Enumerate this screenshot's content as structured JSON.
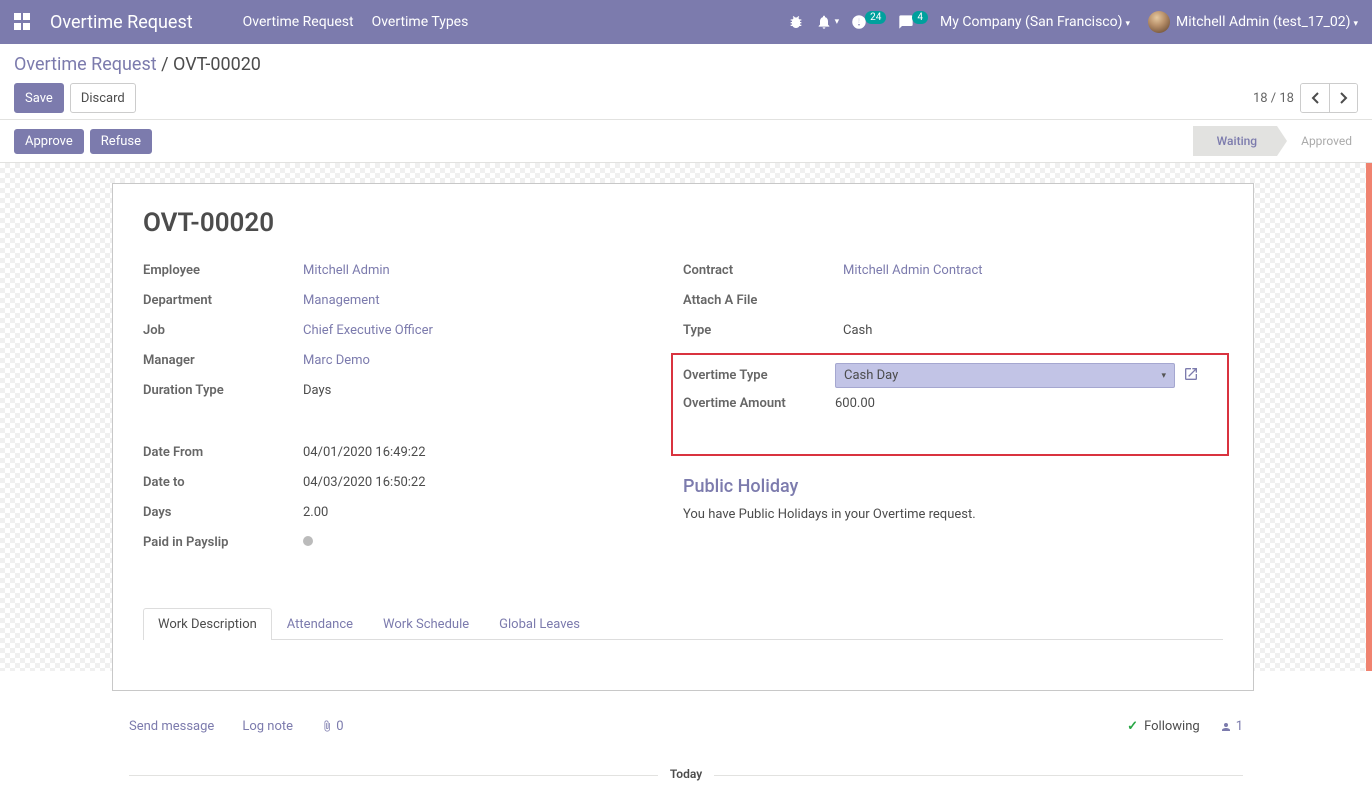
{
  "navbar": {
    "title": "Overtime Request",
    "menu": [
      "Overtime Request",
      "Overtime Types"
    ],
    "activity_badge": "24",
    "discuss_badge": "4",
    "company": "My Company (San Francisco)",
    "user": "Mitchell Admin (test_17_02)"
  },
  "breadcrumb": {
    "root": "Overtime Request",
    "sep": " / ",
    "current": "OVT-00020"
  },
  "controls": {
    "save": "Save",
    "discard": "Discard",
    "pager": "18 / 18"
  },
  "statusbar": {
    "approve": "Approve",
    "refuse": "Refuse",
    "waiting": "Waiting",
    "approved": "Approved"
  },
  "form": {
    "title": "OVT-00020",
    "left1": {
      "employee_label": "Employee",
      "employee": "Mitchell Admin",
      "department_label": "Department",
      "department": "Management",
      "job_label": "Job",
      "job": "Chief Executive Officer",
      "manager_label": "Manager",
      "manager": "Marc Demo",
      "duration_type_label": "Duration Type",
      "duration_type": "Days"
    },
    "left2": {
      "date_from_label": "Date From",
      "date_from": "04/01/2020 16:49:22",
      "date_to_label": "Date to",
      "date_to": "04/03/2020 16:50:22",
      "days_label": "Days",
      "days": "2.00",
      "paid_label": "Paid in Payslip"
    },
    "right": {
      "contract_label": "Contract",
      "contract": "Mitchell Admin Contract",
      "attach_label": "Attach A File",
      "type_label": "Type",
      "type": "Cash",
      "ovt_type_label": "Overtime Type",
      "ovt_type": "Cash Day",
      "ovt_amount_label": "Overtime Amount",
      "ovt_amount": "600.00",
      "ph_title": "Public Holiday",
      "ph_text": "You have Public Holidays in your Overtime request."
    },
    "tabs": [
      "Work Description",
      "Attendance",
      "Work Schedule",
      "Global Leaves"
    ]
  },
  "chatter": {
    "send": "Send message",
    "log": "Log note",
    "attach_count": "0",
    "following": "Following",
    "followers": "1",
    "today": "Today"
  }
}
